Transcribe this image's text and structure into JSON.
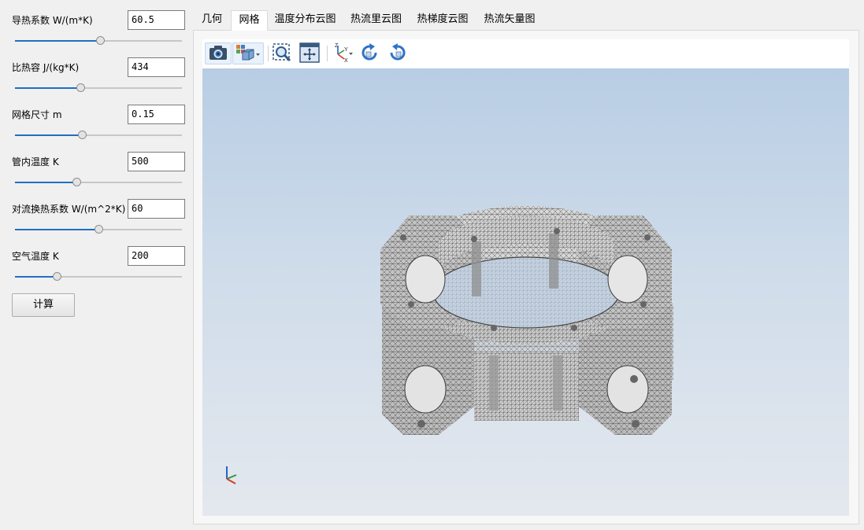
{
  "params": [
    {
      "label": "导热系数 W/(m*K)",
      "value": "60.5",
      "slider": 0.51
    },
    {
      "label": "比热容 J/(kg*K)",
      "value": "434",
      "slider": 0.39
    },
    {
      "label": "网格尺寸 m",
      "value": "0.15",
      "slider": 0.4
    },
    {
      "label": "管内温度 K",
      "value": "500",
      "slider": 0.37
    },
    {
      "label": "对流换热系数 W/(m^2*K)",
      "value": "60",
      "slider": 0.5
    },
    {
      "label": "空气温度 K",
      "value": "200",
      "slider": 0.25
    }
  ],
  "calculate_label": "计算",
  "tabs": [
    {
      "label": "几何",
      "active": false
    },
    {
      "label": "网格",
      "active": true
    },
    {
      "label": "温度分布云图",
      "active": false
    },
    {
      "label": "热流里云图",
      "active": false
    },
    {
      "label": "热梯度云图",
      "active": false
    },
    {
      "label": "热流矢量图",
      "active": false
    }
  ],
  "toolbar": {
    "icons": [
      "camera-icon",
      "view-cube-icon",
      "zoom-fit-icon",
      "fit-all-icon",
      "axes-icon",
      "rotate-cw-icon",
      "rotate-ccw-icon"
    ],
    "axes_letters": {
      "z": "Z",
      "y": "Y",
      "x": "X"
    }
  },
  "colors": {
    "accent": "#1f6fc4",
    "viewport_top": "#b8cde4",
    "viewport_bottom": "#e4e8ee"
  }
}
